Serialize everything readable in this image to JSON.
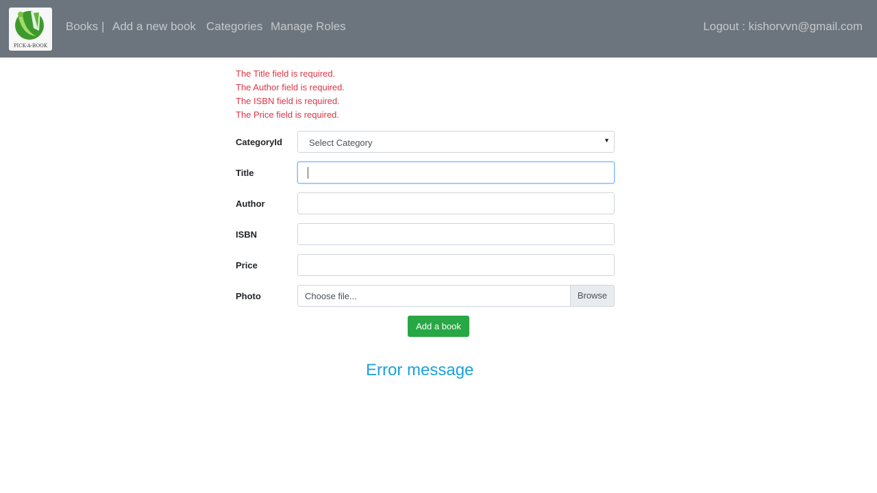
{
  "nav": {
    "logo_text": "PICK-A-BOOK",
    "links": [
      "Books |",
      "Add a new book",
      "Categories",
      "Manage Roles"
    ],
    "logout": "Logout : kishorvvn@gmail.com"
  },
  "errors": [
    "The Title field is required.",
    "The Author field is required.",
    "The ISBN field is required.",
    "The Price field is required."
  ],
  "form": {
    "category_label": "CategoryId",
    "category_value": "Select Category",
    "title_label": "Title",
    "author_label": "Author",
    "isbn_label": "ISBN",
    "price_label": "Price",
    "photo_label": "Photo",
    "photo_placeholder": "Choose file...",
    "browse_label": "Browse",
    "submit_label": "Add a book"
  },
  "caption": "Error message"
}
